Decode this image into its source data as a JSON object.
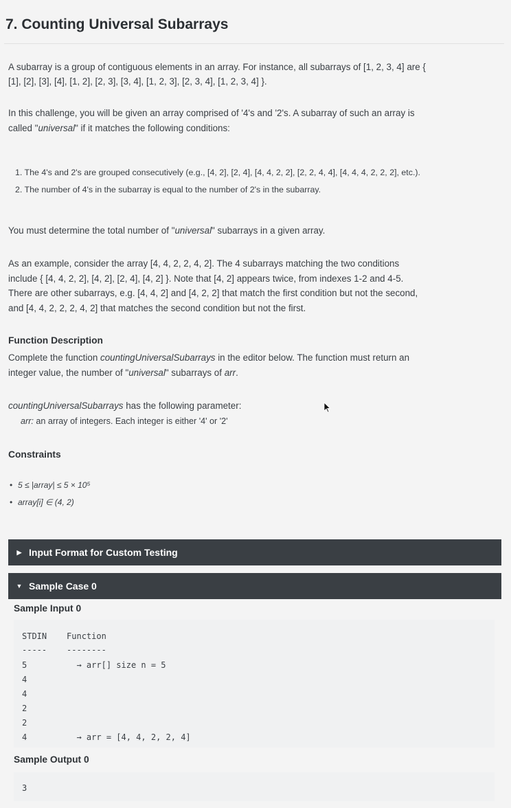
{
  "title": "7. Counting Universal Subarrays",
  "intro": {
    "line1": "A subarray is a group of contiguous elements in an array. For instance, all subarrays of [1, 2, 3, 4] are {",
    "line2": "[1], [2], [3], [4], [1, 2], [2, 3], [3, 4], [1, 2, 3], [2, 3, 4], [1, 2, 3, 4] }."
  },
  "challenge": {
    "line1": "In this challenge, you will be given an array comprised of '4's and '2's. A subarray of such an array is",
    "line2_pre": "called \"",
    "line2_em": "universal",
    "line2_post": "\" if it matches the following conditions:"
  },
  "conditions": [
    "1. The 4's and 2's are grouped consecutively (e.g., [4, 2], [2, 4], [4, 4, 2, 2], [2, 2, 4, 4], [4, 4, 4, 2, 2, 2], etc.).",
    "2. The number of 4's in the subarray is equal to the number of 2's in the subarray."
  ],
  "determine": {
    "pre": "You must determine the total number of \"",
    "em": "universal",
    "post": "\" subarrays in a given array."
  },
  "example": {
    "line1": "As an example, consider the array [4, 4, 2, 2, 4, 2]. The 4 subarrays matching the two conditions",
    "line2": "include { [4, 4, 2, 2], [4, 2], [2, 4], [4, 2] }. Note that [4, 2] appears twice, from indexes 1-2 and 4-5.",
    "line3": "There are other subarrays, e.g. [4, 4, 2] and [4, 2, 2] that match the first condition but not the second,",
    "line4": "and [4, 4, 2, 2, 2, 4, 2] that matches the second condition but not the first."
  },
  "function_description": {
    "heading": "Function Description",
    "line1_pre": "Complete the function ",
    "line1_em": "countingUniversalSubarrays",
    "line1_post": " in the editor below. The function must return an",
    "line2_pre": "integer value, the number of \"",
    "line2_em": "universal",
    "line2_mid": "\" subarrays of ",
    "line2_em2": "arr",
    "line2_post": ".",
    "param_name": "countingUniversalSubarrays",
    "param_rest": " has the following parameter:",
    "arg_name": "arr:",
    "arg_desc": "  an array of integers. Each integer is either '4' or '2'"
  },
  "constraints": {
    "heading": "Constraints",
    "items": [
      "5 ≤ |array| ≤ 5 × 10⁵",
      "array[i] ∈ (4, 2)"
    ]
  },
  "sections": {
    "input_format": {
      "label": "Input Format for Custom Testing",
      "icon": "caret-right-icon"
    },
    "sample_case": {
      "label": "Sample Case 0",
      "icon": "caret-down-icon"
    }
  },
  "sample_input": {
    "heading": "Sample Input 0",
    "lines": [
      "STDIN    Function",
      "-----    --------",
      "5          → arr[] size n = 5",
      "4",
      "4",
      "2",
      "2",
      "4          → arr = [4, 4, 2, 2, 4]"
    ]
  },
  "sample_output": {
    "heading": "Sample Output 0",
    "value": "3"
  },
  "colors": {
    "bar_bg": "#3a3f44",
    "page_bg": "#f4f4f4",
    "code_bg": "#f0f1f2"
  }
}
